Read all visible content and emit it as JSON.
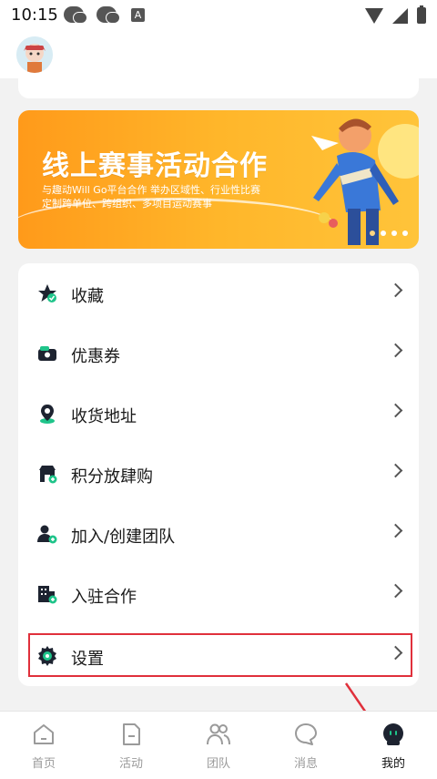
{
  "status": {
    "time": "10:15",
    "badge_letter": "A"
  },
  "banner": {
    "title": "线上赛事活动合作",
    "subtitle_line1": "与趣动Will Go平台合作 举办区域性、行业性比赛",
    "subtitle_line2": "定制跨单位、跨组织、多项目运动赛事",
    "active_color": "#ff9a1a"
  },
  "menu": {
    "items": [
      {
        "label": "收藏",
        "icon": "star-icon"
      },
      {
        "label": "优惠券",
        "icon": "coupon-icon"
      },
      {
        "label": "收货地址",
        "icon": "location-icon"
      },
      {
        "label": "积分放肆购",
        "icon": "shop-icon"
      },
      {
        "label": "加入/创建团队",
        "icon": "add-user-icon"
      },
      {
        "label": "入驻合作",
        "icon": "building-icon"
      },
      {
        "label": "设置",
        "icon": "gear-icon"
      }
    ],
    "accent": "#1fc48a"
  },
  "tabs": [
    {
      "label": "首页",
      "icon": "home-icon"
    },
    {
      "label": "活动",
      "icon": "activity-icon"
    },
    {
      "label": "团队",
      "icon": "team-icon"
    },
    {
      "label": "消息",
      "icon": "message-icon"
    },
    {
      "label": "我的",
      "icon": "profile-icon",
      "active": true
    }
  ],
  "highlight_color": "#e0303b"
}
